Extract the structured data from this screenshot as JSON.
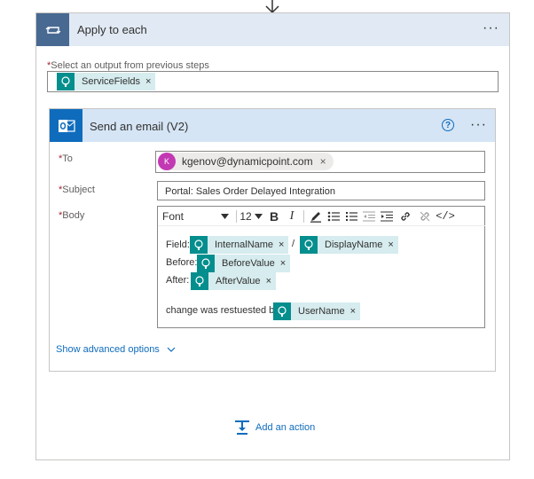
{
  "apply_each": {
    "title": "Apply to each",
    "more": "···",
    "select_label": "Select an output from previous steps",
    "required_mark": "*",
    "token": "ServiceFields",
    "remove": "×"
  },
  "action": {
    "title": "Send an email (V2)",
    "help": "?",
    "more": "···",
    "to_label": "To",
    "to_avatar": "K",
    "to_email": "kgenov@dynamicpoint.com",
    "subject_label": "Subject",
    "subject_value": "Portal: Sales Order Delayed Integration",
    "body_label": "Body",
    "toolbar": {
      "font": "Font",
      "size": "12",
      "bold": "B",
      "italic": "I",
      "code": "</>"
    },
    "body": {
      "field_label": "Field:",
      "separator": "/",
      "before_label": "Before:",
      "after_label": "After:",
      "changed_by_label": "change was restuested by:",
      "tokens": {
        "internal_name": "InternalName",
        "display_name": "DisplayName",
        "before_value": "BeforeValue",
        "after_value": "AfterValue",
        "user_name": "UserName"
      },
      "remove": "×"
    },
    "advanced": "Show advanced options"
  },
  "add_action": "Add an action"
}
